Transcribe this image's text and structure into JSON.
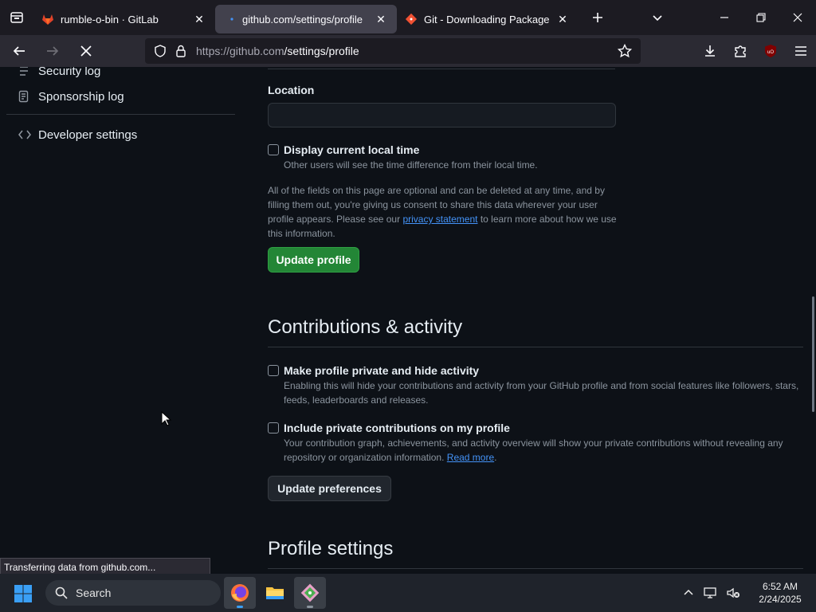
{
  "browser": {
    "tabs": [
      {
        "title": "rumble-o-bin · GitLab",
        "active": false
      },
      {
        "title": "github.com/settings/profile",
        "active": true
      },
      {
        "title": "Git - Downloading Package",
        "active": false
      }
    ],
    "url_host": "https://github.com",
    "url_path": "/settings/profile",
    "status_text": "Transferring data from github.com..."
  },
  "sidebar": {
    "items": [
      {
        "label": "Security log",
        "icon": "log-icon"
      },
      {
        "label": "Sponsorship log",
        "icon": "log-icon"
      },
      {
        "label": "Developer settings",
        "icon": "code-icon"
      }
    ]
  },
  "profile": {
    "location_label": "Location",
    "location_value": "",
    "local_time_label": "Display current local time",
    "local_time_help": "Other users will see the time difference from their local time.",
    "note_before": "All of the fields on this page are optional and can be deleted at any time, and by filling them out, you're giving us consent to share this data wherever your user profile appears. Please see our ",
    "note_link": "privacy statement",
    "note_after": " to learn more about how we use this information.",
    "update_button": "Update profile"
  },
  "contributions": {
    "heading": "Contributions & activity",
    "private_label": "Make profile private and hide activity",
    "private_help": "Enabling this will hide your contributions and activity from your GitHub profile and from social features like followers, stars, feeds, leaderboards and releases.",
    "include_label": "Include private contributions on my profile",
    "include_help": "Your contribution graph, achievements, and activity overview will show your private contributions without revealing any repository or organization information. ",
    "include_link": "Read more",
    "include_after": ".",
    "update_button": "Update preferences"
  },
  "profile_settings": {
    "heading": "Profile settings"
  },
  "taskbar": {
    "search_label": "Search",
    "time": "6:52 AM",
    "date": "2/24/2025"
  },
  "colors": {
    "primary_button": "#238636",
    "link": "#4493f8",
    "background": "#0d1117"
  }
}
